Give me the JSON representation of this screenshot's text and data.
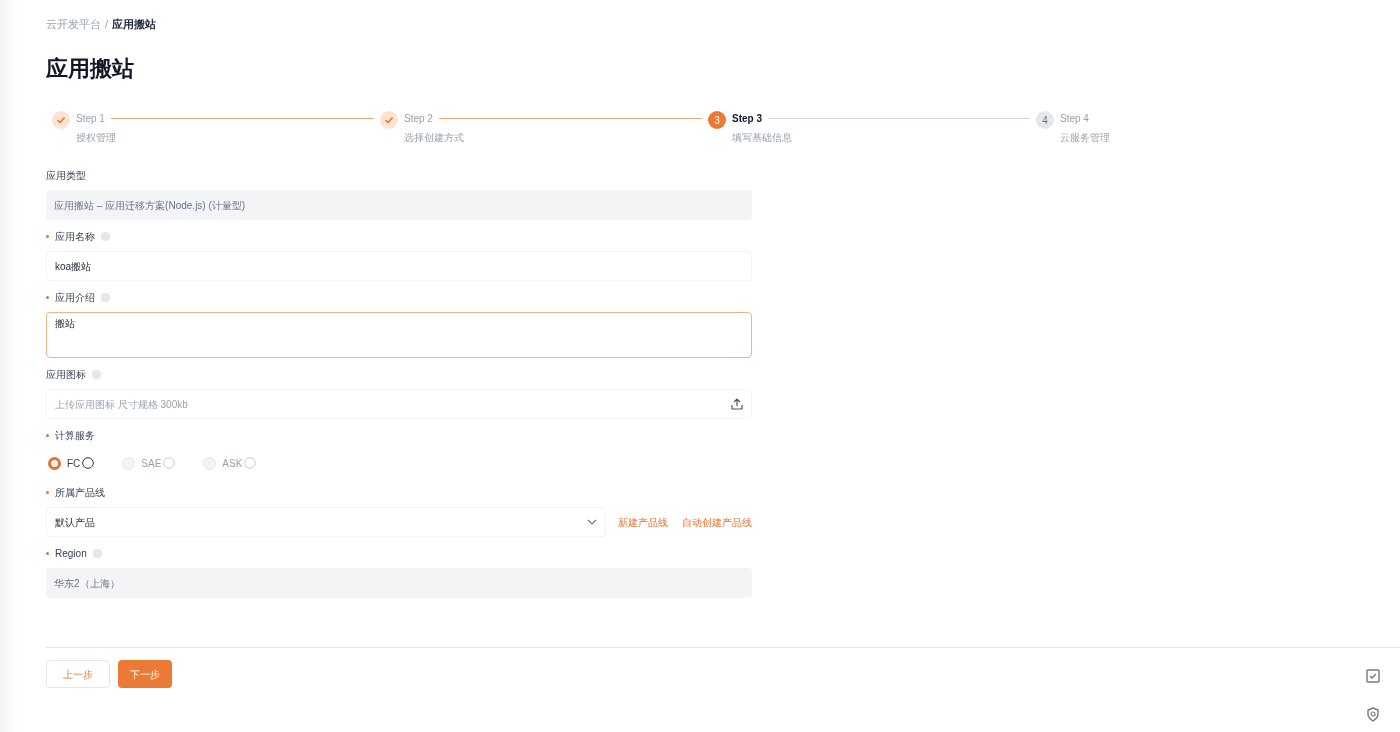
{
  "breadcrumb": [
    {
      "label": "云开发平台",
      "current": false
    },
    {
      "label": "应用搬站",
      "current": true
    }
  ],
  "breadcrumb_separator": "/",
  "title": "应用搬站",
  "steps": [
    {
      "title": "Step 1",
      "subtitle": "授权管理",
      "completed": true,
      "selected": false
    },
    {
      "title": "Step 2",
      "subtitle": "选择创建方式",
      "completed": true,
      "selected": false
    },
    {
      "number": "3",
      "title": "Step 3",
      "subtitle": "填写基础信息",
      "completed": false,
      "selected": true
    },
    {
      "number": "4",
      "title": "Step 4",
      "subtitle": "云服务管理",
      "completed": false,
      "selected": false
    }
  ],
  "fields": [
    {
      "kind": "input",
      "label": "应用类型",
      "required": false,
      "help": false,
      "value": "应用搬站 – 应用迁移方案(Node.js) (计量型)",
      "disabled": true
    },
    {
      "kind": "input",
      "label": "应用名称",
      "required": true,
      "help": true,
      "value": "koa搬站",
      "disabled": false
    },
    {
      "kind": "textarea",
      "label": "应用介绍",
      "required": true,
      "help": true,
      "value": "搬站",
      "focused": true
    },
    {
      "kind": "upload",
      "label": "应用图标",
      "required": false,
      "help": true,
      "placeholder": "上传应用图标 尺寸规格 300kb"
    },
    {
      "kind": "radio",
      "label": "计算服务",
      "required": true,
      "help": false,
      "options": [
        {
          "label": "FC",
          "selected": true,
          "disabled": false
        },
        {
          "label": "SAE",
          "selected": false,
          "disabled": true
        },
        {
          "label": "ASK",
          "selected": false,
          "disabled": true
        }
      ]
    },
    {
      "kind": "select",
      "label": "所属产品线",
      "required": true,
      "help": false,
      "value": "默认产品",
      "links": [
        "新建产品线",
        "自动创建产品线"
      ]
    },
    {
      "kind": "input",
      "label": "Region",
      "required": true,
      "help": true,
      "value": "华东2（上海）",
      "disabled": true
    }
  ],
  "buttons": [
    {
      "label": "上一步",
      "primary": false
    },
    {
      "label": "下一步",
      "primary": true
    }
  ]
}
